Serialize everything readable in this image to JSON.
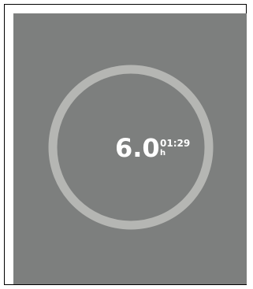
{
  "gauge": {
    "value": "6.0",
    "unit": "h",
    "time": "01:29",
    "progress": 1.0,
    "colors": {
      "panel": "#7d7f7e",
      "ring": "#b5b6b3",
      "text": "#ffffff"
    }
  }
}
